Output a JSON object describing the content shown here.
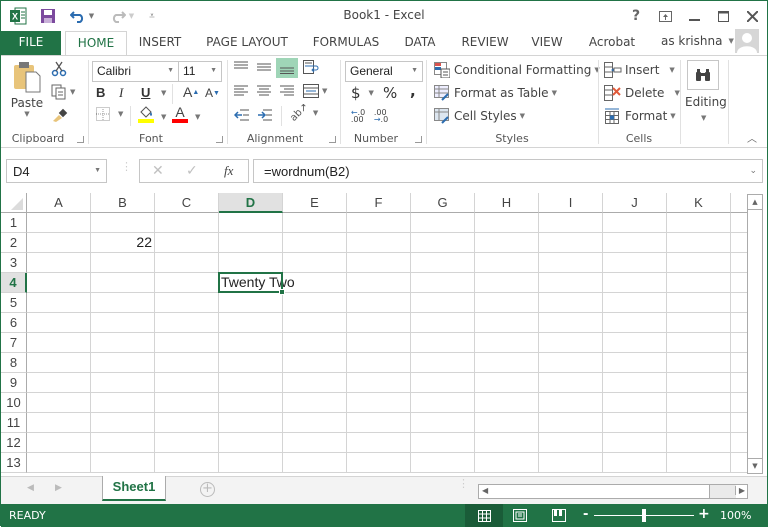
{
  "window": {
    "title": "Book1 - Excel",
    "help_label": "?",
    "controls": [
      "ribbon-display-options",
      "minimize",
      "maximize",
      "close"
    ]
  },
  "quick_access": {
    "items": [
      "excel-logo",
      "save",
      "undo",
      "redo",
      "customize"
    ]
  },
  "tabs": [
    {
      "label": "FILE"
    },
    {
      "label": "HOME",
      "active": true
    },
    {
      "label": "INSERT"
    },
    {
      "label": "PAGE LAYOUT"
    },
    {
      "label": "FORMULAS"
    },
    {
      "label": "DATA"
    },
    {
      "label": "REVIEW"
    },
    {
      "label": "VIEW"
    },
    {
      "label": "Acrobat"
    }
  ],
  "user": {
    "name": "as krishna"
  },
  "ribbon": {
    "clipboard": {
      "label": "Clipboard",
      "paste_label": "Paste"
    },
    "font": {
      "label": "Font",
      "font_name": "Calibri",
      "font_size": "11",
      "bold": "B",
      "italic": "I",
      "underline": "U",
      "highlight_color": "#ffff00",
      "font_color": "#ff0000"
    },
    "alignment": {
      "label": "Alignment"
    },
    "number": {
      "label": "Number",
      "format": "General",
      "currency": "$",
      "percent": "%",
      "comma": ",",
      "inc_decimal": "←.0 .00",
      "dec_decimal": ".00 →.0"
    },
    "styles": {
      "label": "Styles",
      "conditional": "Conditional Formatting",
      "format_table": "Format as Table",
      "cell_styles": "Cell Styles"
    },
    "cells": {
      "label": "Cells",
      "insert": "Insert",
      "delete": "Delete",
      "format": "Format"
    },
    "editing": {
      "label": "Editing"
    }
  },
  "formula_bar": {
    "name_box": "D4",
    "fx_label": "fx",
    "formula": "=wordnum(B2)"
  },
  "sheet": {
    "columns": [
      "A",
      "B",
      "C",
      "D",
      "E",
      "F",
      "G",
      "H",
      "I",
      "J",
      "K"
    ],
    "rows": [
      "1",
      "2",
      "3",
      "4",
      "5",
      "6",
      "7",
      "8",
      "9",
      "10",
      "11",
      "12",
      "13"
    ],
    "selected_cell": "D4",
    "cells": {
      "B2": "22",
      "D4": "Twenty Two"
    }
  },
  "sheet_tabs": {
    "tabs": [
      {
        "label": "Sheet1",
        "active": true
      }
    ]
  },
  "status_bar": {
    "status": "READY",
    "zoom": "100%",
    "zoom_minus": "-",
    "zoom_plus": "+"
  },
  "colors": {
    "accent": "#217346"
  }
}
